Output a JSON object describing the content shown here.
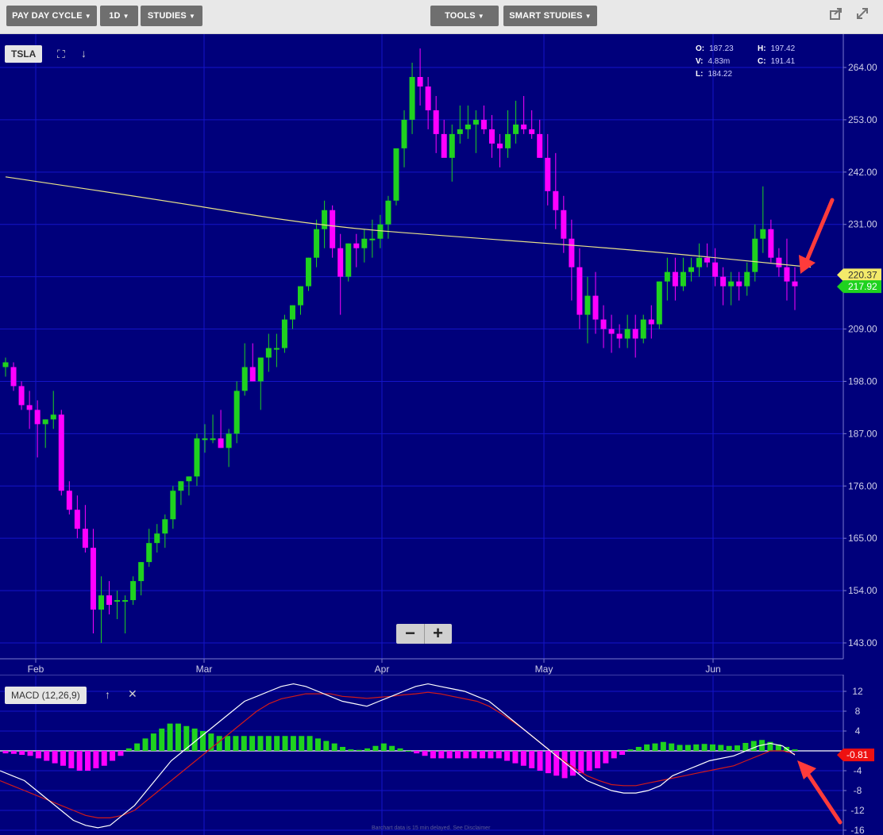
{
  "toolbar": {
    "left_buttons": [
      "PAY DAY CYCLE",
      "1D",
      "STUDIES"
    ],
    "center_buttons": [
      "TOOLS",
      "SMART STUDIES"
    ],
    "right_icons": [
      "share-icon",
      "expand-icon"
    ]
  },
  "main_chart": {
    "symbol": "TSLA",
    "ohlc": {
      "O": "187.23",
      "H": "197.42",
      "V": "4.83m",
      "C": "191.41",
      "L": "184.22"
    },
    "price_ticks": [
      "264.00",
      "253.00",
      "242.00",
      "231.00",
      "220.37",
      "209.00",
      "198.00",
      "187.00",
      "176.00",
      "165.00",
      "154.00",
      "143.00"
    ],
    "current_price_label": "217.92",
    "ma_price_label": "220.37",
    "x_labels": [
      "Feb",
      "Mar",
      "Apr",
      "May",
      "Jun"
    ],
    "colors": {
      "background": "#00007b",
      "up": "#1fd21f",
      "down": "#ff00ff",
      "ma": "#e8e28a",
      "grid": "#1414c8"
    }
  },
  "macd_panel": {
    "label": "MACD (12,26,9)",
    "y_ticks": [
      "12",
      "8",
      "4",
      "0",
      "-4",
      "-8",
      "-12",
      "-16"
    ],
    "current_label": "-0.81",
    "colors": {
      "macd_line": "#ffffff",
      "signal_line": "#d11a1a",
      "hist_up": "#1fd21f",
      "hist_down": "#ff00ff"
    }
  },
  "zoom": {
    "minus": "−",
    "plus": "+"
  },
  "disclaimer": "Barchart data is 15 min delayed. See Disclaimer",
  "chart_data": [
    {
      "type": "candlestick",
      "title": "TSLA",
      "xlabel": "",
      "ylabel": "",
      "ylim": [
        139,
        269
      ],
      "x_labels": [
        "Feb",
        "Mar",
        "Apr",
        "May",
        "Jun"
      ],
      "candles": [
        [
          201,
          203,
          199,
          202
        ],
        [
          201,
          202,
          196,
          197
        ],
        [
          197,
          198,
          192,
          193
        ],
        [
          193,
          196,
          188,
          192
        ],
        [
          192,
          194,
          182,
          189
        ],
        [
          189,
          190,
          184,
          190
        ],
        [
          190,
          196,
          188,
          191
        ],
        [
          191,
          192,
          174,
          175
        ],
        [
          175,
          177,
          170,
          171
        ],
        [
          171,
          174,
          165,
          167
        ],
        [
          167,
          172,
          162,
          163
        ],
        [
          163,
          167,
          145,
          150
        ],
        [
          150,
          157,
          143,
          153
        ],
        [
          153,
          156,
          149,
          151
        ],
        [
          152,
          154,
          148,
          152
        ],
        [
          152,
          153,
          145,
          152
        ],
        [
          152,
          157,
          151,
          156
        ],
        [
          156,
          160,
          153,
          160
        ],
        [
          160,
          167,
          159,
          164
        ],
        [
          164,
          168,
          162,
          166
        ],
        [
          166,
          170,
          163,
          169
        ],
        [
          169,
          176,
          167,
          175
        ],
        [
          175,
          177,
          172,
          177
        ],
        [
          177,
          178,
          174,
          178
        ],
        [
          178,
          187,
          176,
          186
        ],
        [
          186,
          189,
          183,
          186
        ],
        [
          186,
          191,
          185,
          186
        ],
        [
          186,
          192,
          184,
          184
        ],
        [
          184,
          188,
          180,
          187
        ],
        [
          187,
          198,
          185,
          196
        ],
        [
          196,
          206,
          195,
          201
        ],
        [
          201,
          206,
          198,
          198
        ],
        [
          198,
          202,
          192,
          203
        ],
        [
          203,
          208,
          200,
          205
        ],
        [
          205,
          208,
          201,
          205
        ],
        [
          205,
          212,
          204,
          211
        ],
        [
          211,
          214,
          209,
          214
        ],
        [
          214,
          218,
          212,
          218
        ],
        [
          218,
          224,
          217,
          224
        ],
        [
          224,
          232,
          222,
          230
        ],
        [
          230,
          236,
          226,
          234
        ],
        [
          234,
          235,
          224,
          226
        ],
        [
          226,
          229,
          212,
          220
        ],
        [
          220,
          227,
          219,
          227
        ],
        [
          227,
          229,
          222,
          226
        ],
        [
          226,
          230,
          223,
          228
        ],
        [
          228,
          232,
          224,
          228
        ],
        [
          228,
          233,
          226,
          231
        ],
        [
          231,
          237,
          228,
          236
        ],
        [
          236,
          246,
          235,
          247
        ],
        [
          247,
          255,
          243,
          253
        ],
        [
          253,
          265,
          250,
          262
        ],
        [
          262,
          268,
          256,
          260
        ],
        [
          260,
          262,
          251,
          255
        ],
        [
          255,
          258,
          246,
          250
        ],
        [
          250,
          253,
          246,
          245
        ],
        [
          245,
          252,
          240,
          250
        ],
        [
          250,
          256,
          248,
          251
        ],
        [
          251,
          256,
          249,
          252
        ],
        [
          252,
          255,
          246,
          253
        ],
        [
          253,
          256,
          250,
          251
        ],
        [
          251,
          254,
          245,
          248
        ],
        [
          248,
          250,
          243,
          247
        ],
        [
          247,
          255,
          245,
          250
        ],
        [
          250,
          257,
          248,
          252
        ],
        [
          252,
          258,
          250,
          251
        ],
        [
          251,
          255,
          249,
          250
        ],
        [
          250,
          253,
          245,
          245
        ],
        [
          245,
          250,
          235,
          238
        ],
        [
          238,
          246,
          230,
          234
        ],
        [
          234,
          237,
          225,
          228
        ],
        [
          228,
          232,
          215,
          222
        ],
        [
          222,
          226,
          209,
          212
        ],
        [
          212,
          220,
          206,
          216
        ],
        [
          216,
          221,
          208,
          211
        ],
        [
          211,
          214,
          205,
          209
        ],
        [
          209,
          212,
          204,
          208
        ],
        [
          208,
          210,
          205,
          207
        ],
        [
          207,
          212,
          205,
          209
        ],
        [
          209,
          212,
          203,
          207
        ],
        [
          207,
          212,
          206,
          211
        ],
        [
          211,
          214,
          207,
          210
        ],
        [
          210,
          219,
          209,
          219
        ],
        [
          219,
          224,
          215,
          221
        ],
        [
          221,
          224,
          215,
          218
        ],
        [
          218,
          224,
          217,
          221
        ],
        [
          221,
          224,
          219,
          222
        ],
        [
          222,
          227,
          220,
          224
        ],
        [
          224,
          227,
          222,
          223
        ],
        [
          223,
          226,
          218,
          220
        ],
        [
          220,
          222,
          214,
          218
        ],
        [
          218,
          221,
          214,
          219
        ],
        [
          219,
          221,
          215,
          218
        ],
        [
          218,
          223,
          216,
          221
        ],
        [
          221,
          231,
          219,
          228
        ],
        [
          228,
          239,
          225,
          230
        ],
        [
          230,
          232,
          223,
          224
        ],
        [
          224,
          226,
          220,
          222
        ],
        [
          222,
          228,
          215,
          219
        ],
        [
          219,
          222,
          213,
          218
        ]
      ],
      "ma_line": [
        [
          0,
          241
        ],
        [
          20,
          236
        ],
        [
          40,
          230.5
        ],
        [
          60,
          228
        ],
        [
          80,
          225.5
        ],
        [
          101,
          222
        ]
      ]
    },
    {
      "type": "line",
      "title": "MACD (12,26,9)",
      "xlabel": "",
      "ylabel": "",
      "ylim": [
        -16,
        14
      ],
      "series": [
        {
          "name": "MACD",
          "values": [
            -4,
            -5,
            -6,
            -8,
            -10,
            -12,
            -14,
            -15,
            -15.5,
            -15,
            -13,
            -11,
            -8,
            -5,
            -2,
            0,
            2,
            4,
            6,
            8,
            10,
            11,
            12,
            13,
            13.5,
            13,
            12,
            11,
            10,
            9.5,
            9,
            10,
            11,
            12,
            13,
            13.5,
            13,
            12.5,
            12,
            11,
            10,
            8,
            6,
            4,
            2,
            0,
            -2,
            -4,
            -6,
            -7,
            -8,
            -8.5,
            -8.5,
            -8,
            -7,
            -5,
            -4,
            -3,
            -2,
            -1.5,
            -1,
            0,
            1,
            1.5,
            1,
            -0.81
          ]
        },
        {
          "name": "Signal",
          "values": [
            -6,
            -7,
            -8,
            -9,
            -10,
            -11,
            -12,
            -13,
            -13.5,
            -13.5,
            -13,
            -12,
            -10,
            -8,
            -6,
            -4,
            -2,
            0,
            2,
            4,
            6,
            8,
            9.5,
            10.5,
            11,
            11.5,
            11.5,
            11.5,
            11,
            10.8,
            10.6,
            10.8,
            11,
            11.3,
            11.5,
            11.8,
            11.5,
            11,
            10.5,
            10,
            9,
            7.5,
            5.8,
            4,
            2,
            0,
            -1.8,
            -3.5,
            -5,
            -6,
            -6.8,
            -7,
            -7,
            -6.5,
            -6,
            -5.5,
            -5,
            -4.5,
            -4,
            -3.5,
            -3,
            -2,
            -1,
            0,
            0,
            -0.6
          ]
        }
      ],
      "histogram": [
        -0.5,
        -0.6,
        -0.8,
        -1,
        -1.5,
        -2,
        -2.5,
        -3,
        -3.5,
        -4,
        -4,
        -3.5,
        -3,
        -2,
        -1,
        0.5,
        1.5,
        2.5,
        3.5,
        4.5,
        5.5,
        5.5,
        5,
        4.5,
        4,
        3.5,
        3,
        3,
        3,
        3,
        3,
        3,
        3,
        3,
        3,
        3,
        3,
        3,
        2.5,
        2,
        1.5,
        0.8,
        0.3,
        0.2,
        0.5,
        1,
        1.5,
        1,
        0.5,
        0,
        -0.5,
        -1,
        -1.5,
        -1.5,
        -1.5,
        -1.5,
        -1.5,
        -1.5,
        -1.5,
        -1.5,
        -1.5,
        -2,
        -2.5,
        -3,
        -3.5,
        -4,
        -4.5,
        -5,
        -5.5,
        -5,
        -4.5,
        -4,
        -3.5,
        -2.5,
        -1.5,
        -0.8,
        0.3,
        0.8,
        1.3,
        1.5,
        1.8,
        1.5,
        1.2,
        1.2,
        1.3,
        1.4,
        1.3,
        1.2,
        1,
        1.1,
        1.6,
        2,
        2.2,
        1.8,
        1.3,
        0.8,
        0.3
      ]
    }
  ]
}
